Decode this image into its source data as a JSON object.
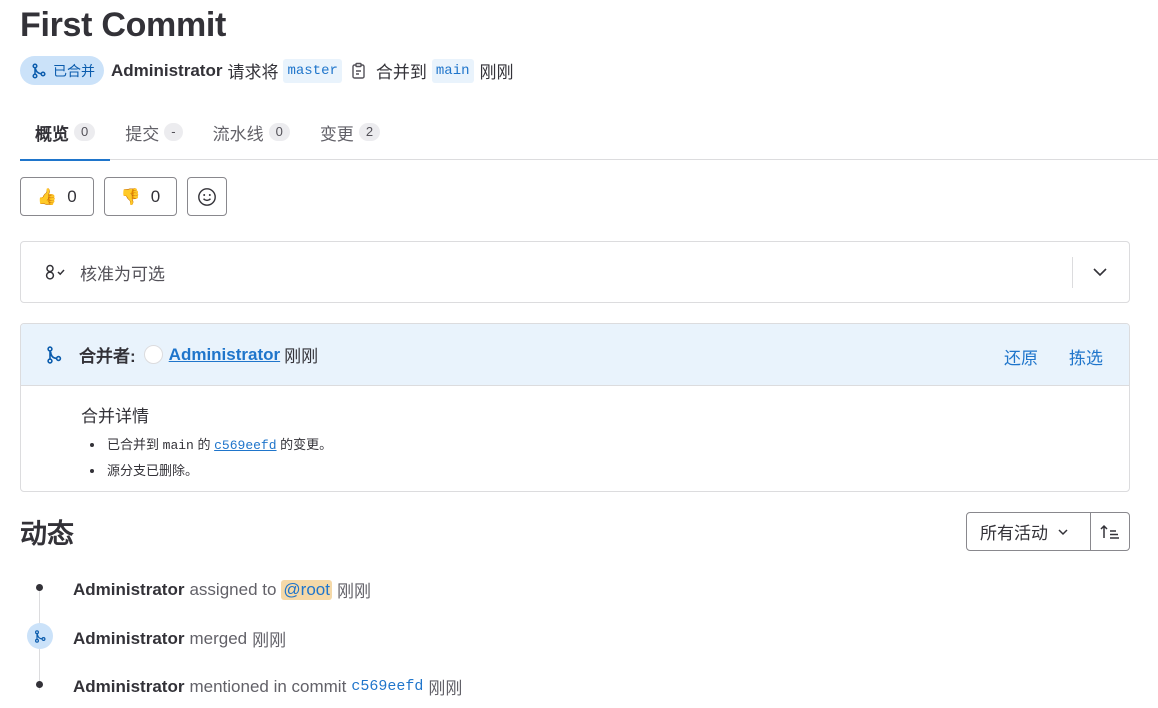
{
  "page": {
    "title": "First Commit"
  },
  "meta": {
    "status": "已合并",
    "author": "Administrator",
    "text_request": "请求将",
    "source_branch": "master",
    "text_merge_to": "合并到",
    "target_branch": "main",
    "time": "刚刚"
  },
  "tabs": [
    {
      "label": "概览",
      "count": "0"
    },
    {
      "label": "提交",
      "count": "-"
    },
    {
      "label": "流水线",
      "count": "0"
    },
    {
      "label": "变更",
      "count": "2"
    }
  ],
  "awards": {
    "thumbsup_count": "0",
    "thumbsdown_count": "0"
  },
  "approval": {
    "text": "核准为可选"
  },
  "merged": {
    "label": "合并者:",
    "user": "Administrator",
    "time": "刚刚",
    "revert_label": "还原",
    "cherry_pick_label": "拣选",
    "details_title": "合并详情",
    "detail_1_prefix": "已合并到",
    "detail_1_branch": "main",
    "detail_1_mid": "的",
    "detail_1_commit": "c569eefd",
    "detail_1_suffix": "的变更。",
    "detail_2": "源分支已删除。"
  },
  "activity": {
    "title": "动态",
    "filter_label": "所有活动",
    "items": [
      {
        "author": "Administrator",
        "text": "assigned to",
        "mention": "@root",
        "time": "刚刚"
      },
      {
        "author": "Administrator",
        "text": "merged",
        "time": "刚刚"
      },
      {
        "author": "Administrator",
        "text": "mentioned in commit",
        "commit": "c569eefd",
        "time": "刚刚"
      }
    ]
  },
  "colors": {
    "accent": "#1f75cb",
    "merged_bg": "#e9f3fc",
    "badge_bg": "#cbe2f9",
    "mention_bg": "#f5d9a8"
  }
}
